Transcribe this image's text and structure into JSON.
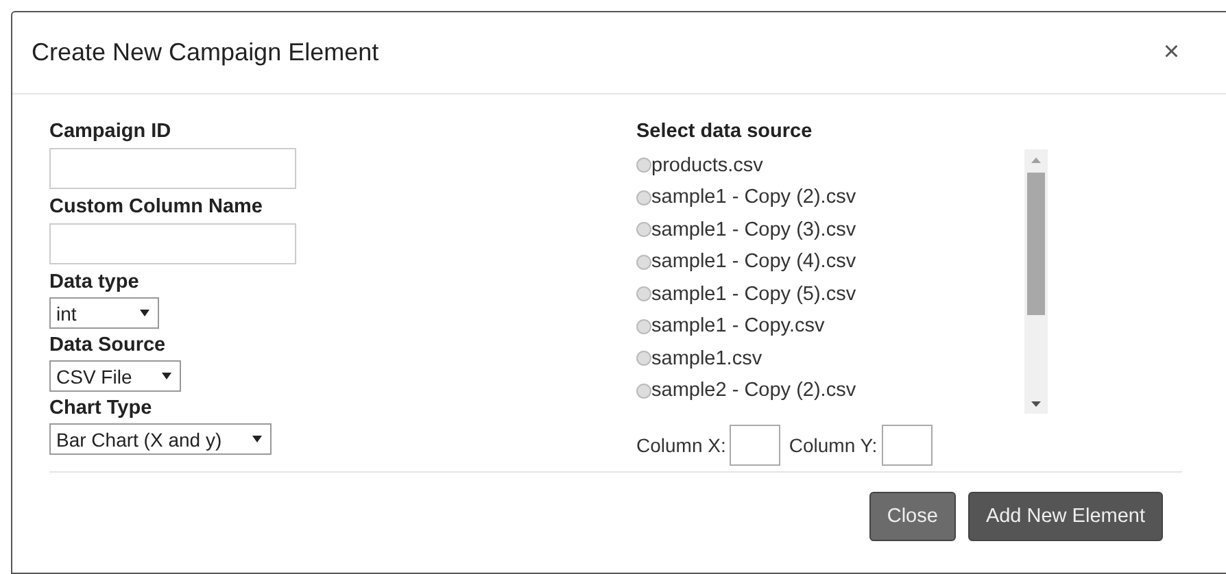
{
  "dialog": {
    "title": "Create New Campaign Element",
    "close": "×"
  },
  "fields": [
    {
      "kind": "text",
      "label": "Campaign ID"
    },
    {
      "kind": "text",
      "label": "Custom Column Name"
    },
    {
      "kind": "select",
      "label": "Data type",
      "value": "int"
    },
    {
      "kind": "select",
      "label": "Data Source",
      "value": "CSV File"
    },
    {
      "kind": "select",
      "label": "Chart Type",
      "value": "Bar Chart (X and y)"
    }
  ],
  "data_source": {
    "label": "Select data source",
    "options": [
      {
        "label": "products.csv",
        "selected": false
      },
      {
        "label": "sample1 - Copy (2).csv",
        "selected": false
      },
      {
        "label": "sample1 - Copy (3).csv",
        "selected": false
      },
      {
        "label": "sample1 - Copy (4).csv",
        "selected": false
      },
      {
        "label": "sample1 - Copy (5).csv",
        "selected": false
      },
      {
        "label": "sample1 - Copy.csv",
        "selected": false
      },
      {
        "label": "sample1.csv",
        "selected": false
      },
      {
        "label": "sample2 - Copy (2).csv",
        "selected": false
      }
    ]
  },
  "columns": [
    {
      "label": "Column X:"
    },
    {
      "label": "Column Y:"
    }
  ],
  "buttons": [
    {
      "label": "Close",
      "kind": "secondary"
    },
    {
      "label": "Add New Element",
      "kind": "primary"
    }
  ]
}
